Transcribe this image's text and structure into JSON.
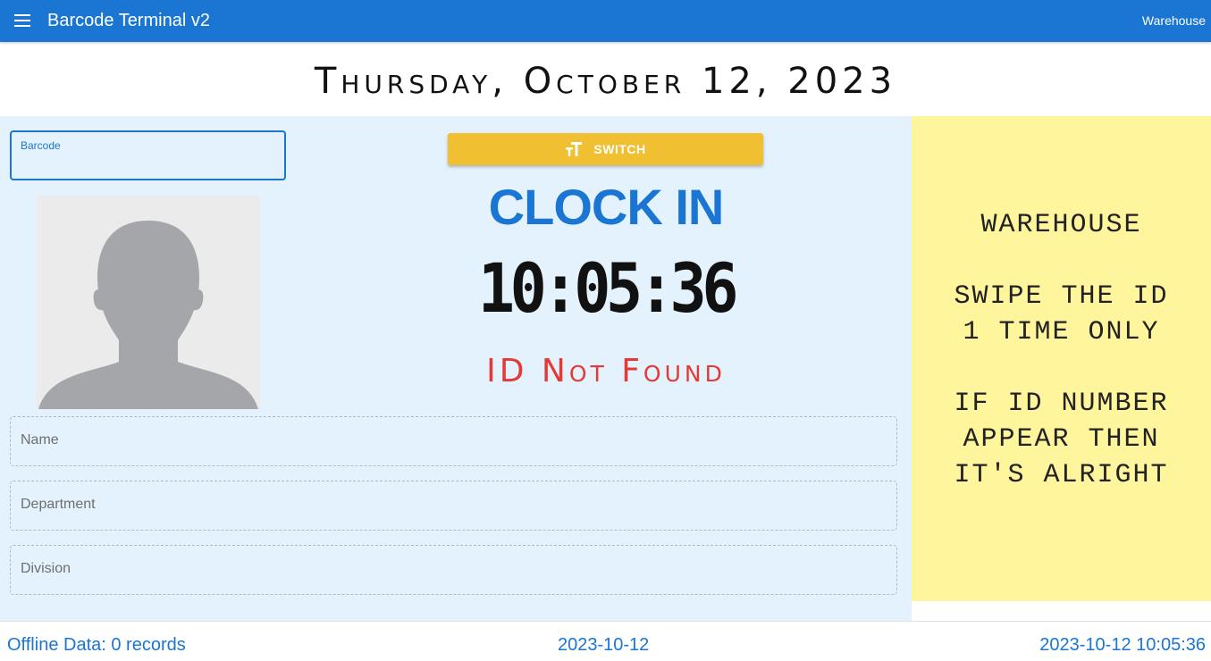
{
  "appbar": {
    "title": "Barcode Terminal v2",
    "right_label": "Warehouse",
    "menu_icon": "menu-icon",
    "color": "#1a76d2"
  },
  "date_heading": "Thursday, October 12, 2023",
  "barcode": {
    "label": "Barcode",
    "value": ""
  },
  "photo": {
    "icon": "person-silhouette-icon"
  },
  "switch_button": {
    "label": "SWITCH",
    "icon": "text-size-icon",
    "color": "#f1c032"
  },
  "clock": {
    "mode": "CLOCK IN",
    "time": "10:05:36",
    "status": "ID Not Found",
    "mode_color": "#1a76d2",
    "status_color": "#e53935"
  },
  "fields": {
    "name": {
      "label": "Name",
      "value": ""
    },
    "department": {
      "label": "Department",
      "value": ""
    },
    "division": {
      "label": "Division",
      "value": ""
    }
  },
  "notice": {
    "lines": [
      "WAREHOUSE",
      "",
      "SWIPE THE ID",
      "1 TIME ONLY",
      "",
      "IF ID NUMBER",
      "APPEAR THEN",
      "IT'S ALRIGHT"
    ],
    "background": "#fff59d"
  },
  "footer": {
    "offline_data": "Offline Data: 0 records",
    "date": "2023-10-12",
    "datetime": "2023-10-12 10:05:36"
  }
}
